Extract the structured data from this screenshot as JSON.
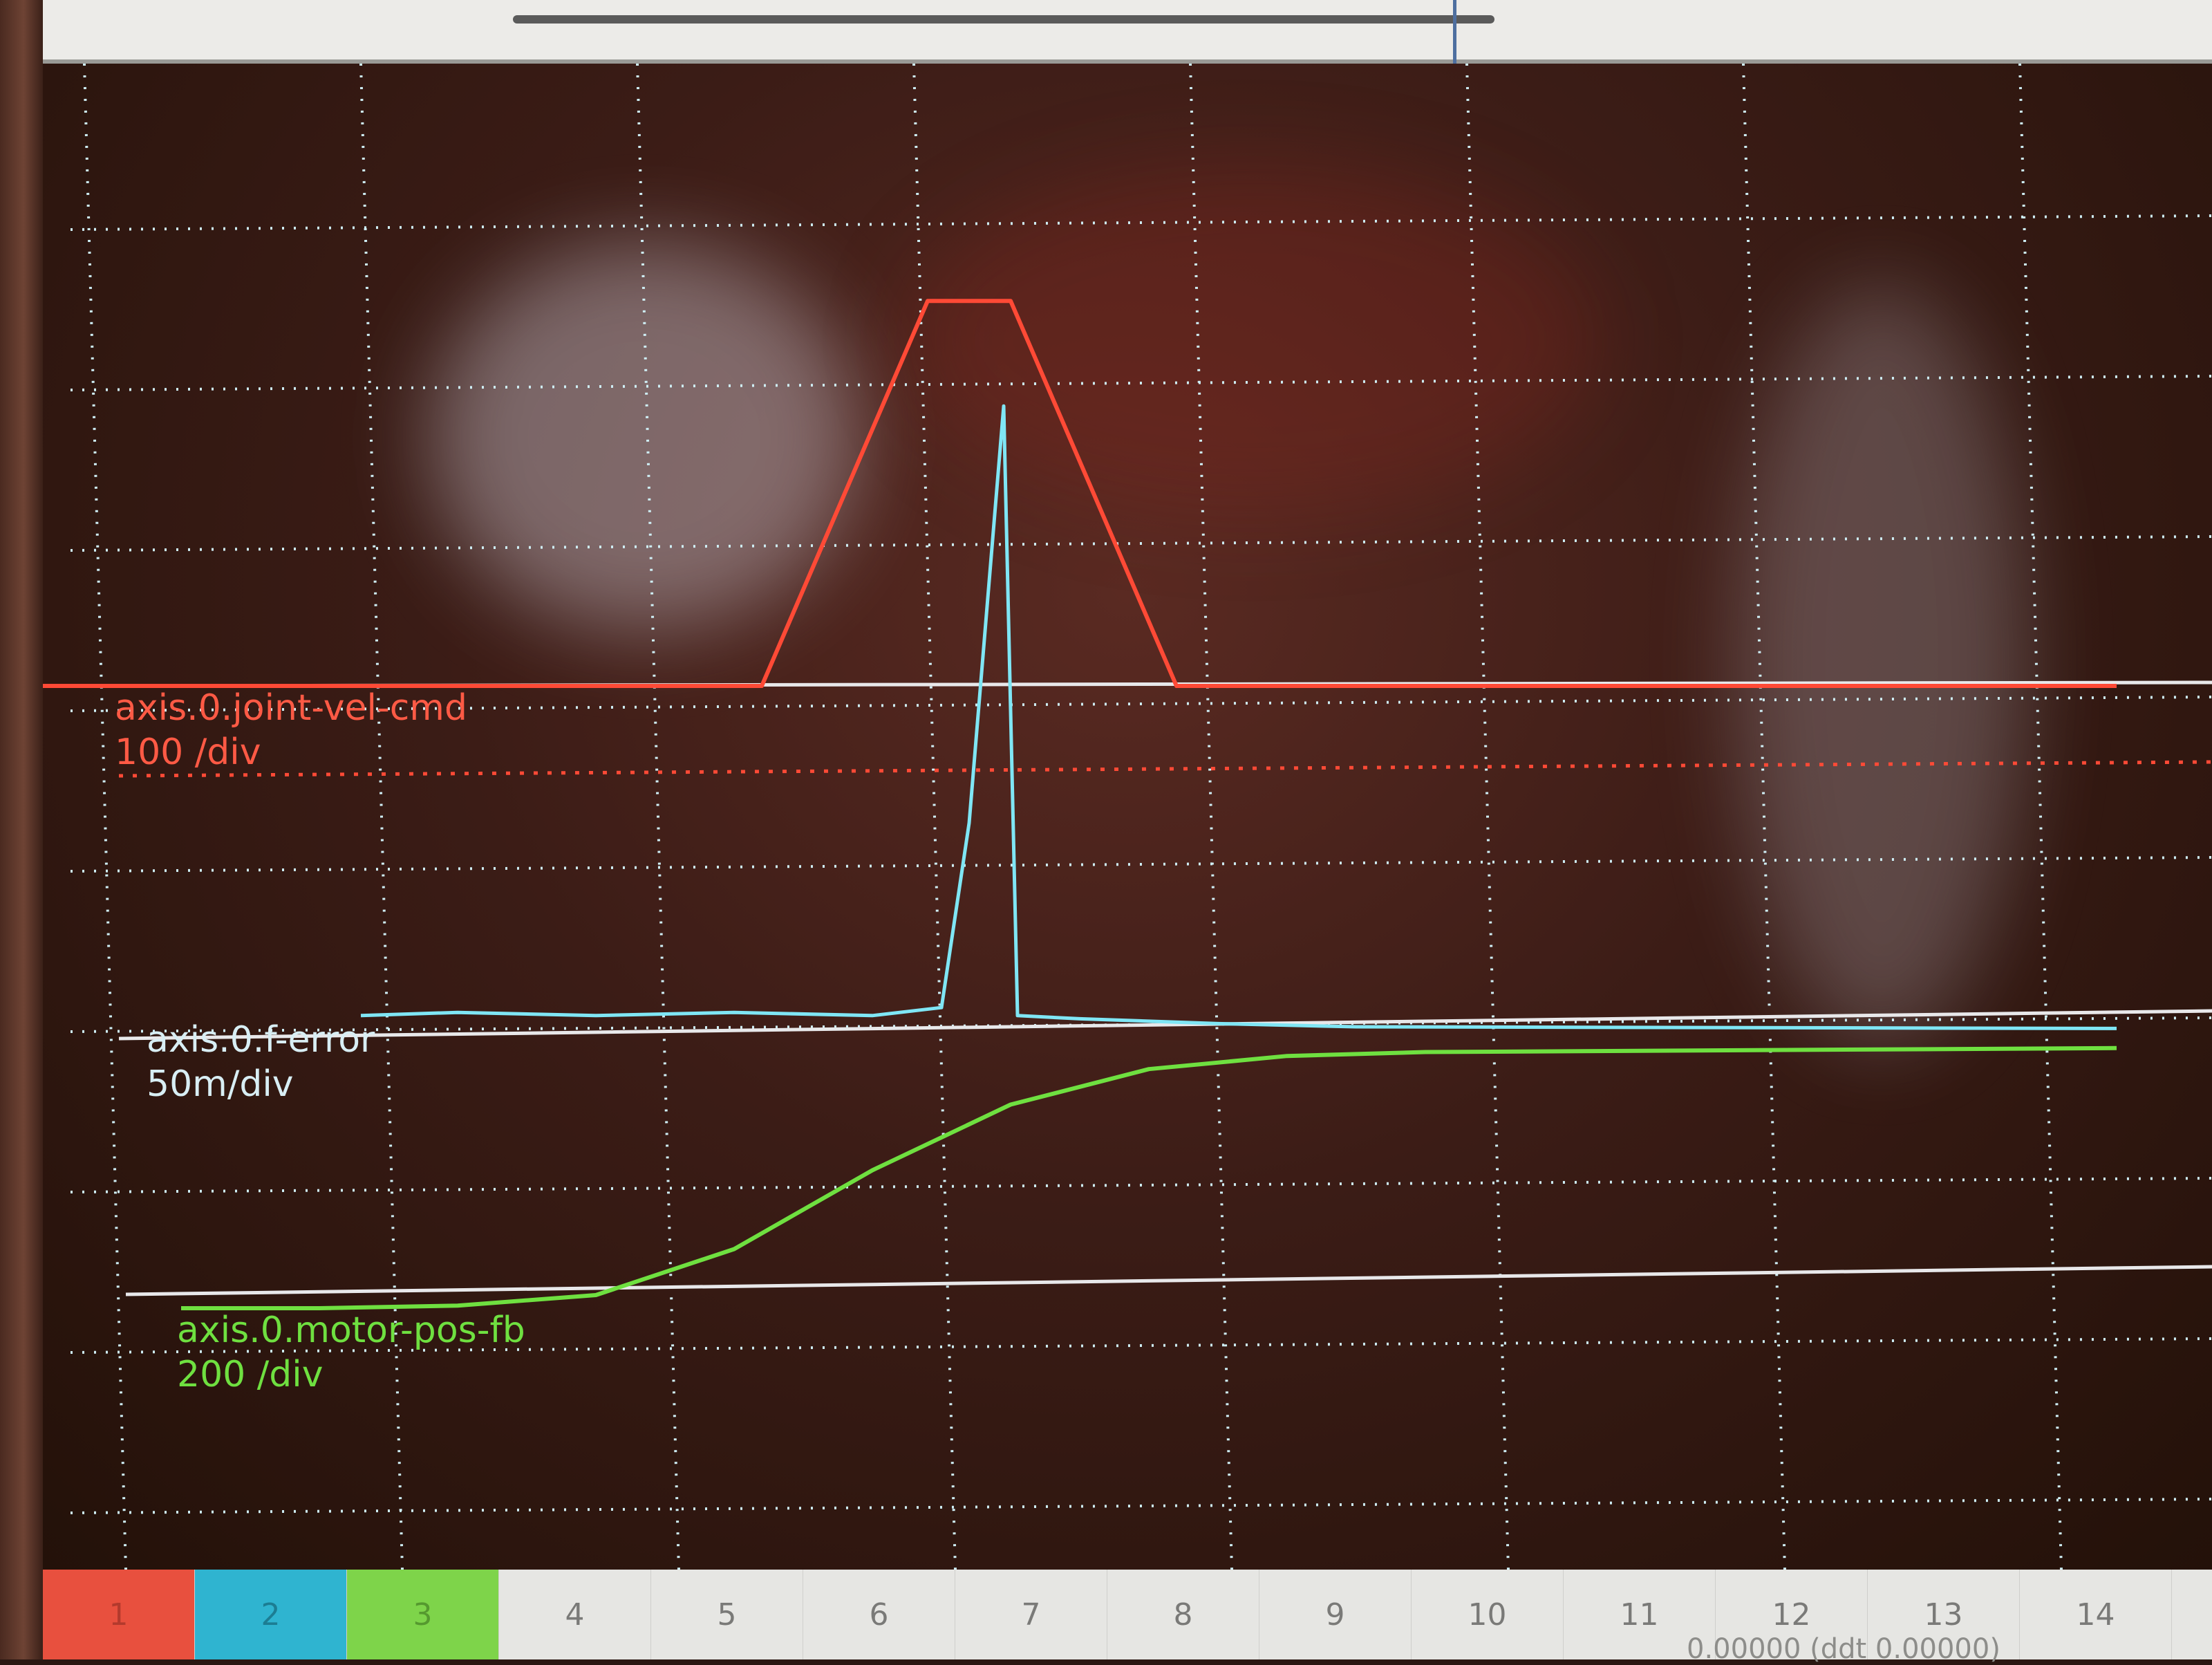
{
  "channels": [
    {
      "name": "axis.0.joint-vel-cmd",
      "scale": "100 /div",
      "color": "#ff4a36"
    },
    {
      "name": "axis.0.f-error",
      "scale": "50m/div",
      "color": "#7fe6f5"
    },
    {
      "name": "axis.0.motor-pos-fb",
      "scale": "200 /div",
      "color": "#6fe040"
    }
  ],
  "channel_buttons": [
    "1",
    "2",
    "3",
    "4",
    "5",
    "6",
    "7",
    "8",
    "9",
    "10",
    "11",
    "12",
    "13",
    "14"
  ],
  "status_text": "0.00000 (ddt  0.00000)",
  "chart_data": {
    "type": "line",
    "grid": true,
    "x": [
      0,
      1,
      2,
      3,
      4,
      5,
      6,
      7,
      8,
      9,
      10,
      11,
      12,
      13,
      14,
      15
    ],
    "series": [
      {
        "name": "axis.0.joint-vel-cmd",
        "color": "#ff4a36",
        "points": [
          [
            0,
            0
          ],
          [
            3,
            0
          ],
          [
            5.2,
            0
          ],
          [
            6.4,
            2.4
          ],
          [
            7.0,
            2.4
          ],
          [
            8.2,
            0
          ],
          [
            10,
            0
          ],
          [
            15,
            0
          ]
        ]
      },
      {
        "name": "axis.0.f-error",
        "color": "#7fe6f5",
        "points": [
          [
            2.3,
            0.1
          ],
          [
            3,
            0.12
          ],
          [
            4,
            0.1
          ],
          [
            5,
            0.12
          ],
          [
            6,
            0.1
          ],
          [
            6.5,
            0.15
          ],
          [
            6.7,
            1.3
          ],
          [
            6.95,
            3.9
          ],
          [
            7.05,
            0.1
          ],
          [
            7.5,
            0.08
          ],
          [
            8.5,
            0.05
          ],
          [
            9.5,
            0.03
          ],
          [
            15,
            0.02
          ]
        ]
      },
      {
        "name": "axis.0.motor-pos-fb",
        "color": "#6fe040",
        "points": [
          [
            1,
            0
          ],
          [
            2,
            0
          ],
          [
            3,
            0.02
          ],
          [
            4,
            0.1
          ],
          [
            5,
            0.45
          ],
          [
            6,
            1.05
          ],
          [
            7,
            1.55
          ],
          [
            8,
            1.82
          ],
          [
            9,
            1.92
          ],
          [
            10,
            1.95
          ],
          [
            15,
            1.98
          ]
        ]
      }
    ]
  }
}
